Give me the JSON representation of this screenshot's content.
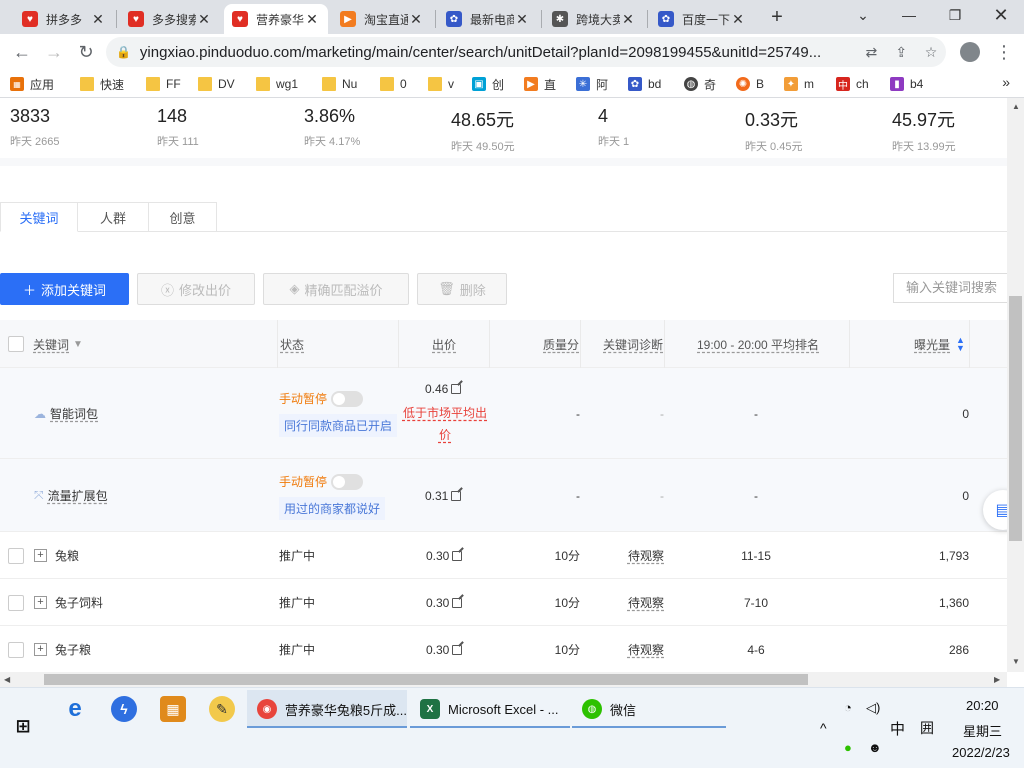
{
  "browser": {
    "tabs": [
      {
        "label": "拼多多",
        "fav_color": "#e02e24"
      },
      {
        "label": "多多搜索",
        "fav_color": "#e02e24"
      },
      {
        "label": "营养豪华",
        "fav_color": "#e02e24",
        "active": true
      },
      {
        "label": "淘宝直通",
        "fav_color": "#f27c20"
      },
      {
        "label": "最新电商",
        "fav_color": "#3659c8"
      },
      {
        "label": "跨境大卖",
        "fav_color": "#555555"
      },
      {
        "label": "百度一下",
        "fav_color": "#3659c8"
      }
    ],
    "url": "yingxiao.pinduoduo.com/marketing/main/center/search/unitDetail?planId=2098199455&unitId=25749...",
    "bookmarks": [
      {
        "label": "应用"
      },
      {
        "label": "快速"
      },
      {
        "label": "FF"
      },
      {
        "label": "DV"
      },
      {
        "label": "wg1"
      },
      {
        "label": "Nu"
      },
      {
        "label": "0"
      },
      {
        "label": "v"
      },
      {
        "label": "创"
      },
      {
        "label": "直"
      },
      {
        "label": "阿"
      },
      {
        "label": "bd"
      },
      {
        "label": "奇"
      },
      {
        "label": "B"
      },
      {
        "label": "m"
      },
      {
        "label": "ch"
      },
      {
        "label": "b4"
      }
    ]
  },
  "stats": [
    {
      "value": "3833",
      "yesterday": "昨天 2665"
    },
    {
      "value": "148",
      "yesterday": "昨天 111"
    },
    {
      "value": "3.86%",
      "yesterday": "昨天 4.17%"
    },
    {
      "value": "48.65元",
      "yesterday": "昨天 49.50元"
    },
    {
      "value": "4",
      "yesterday": "昨天 1"
    },
    {
      "value": "0.33元",
      "yesterday": "昨天 0.45元"
    },
    {
      "value": "45.97元",
      "yesterday": "昨天 13.99元"
    }
  ],
  "page_tabs": [
    "关键词",
    "人群",
    "创意"
  ],
  "actions": {
    "add": "添加关键词",
    "modify": "修改出价",
    "precise": "精确匹配溢价",
    "delete": "删除",
    "search_placeholder": "输入关键词搜索"
  },
  "table": {
    "headers": {
      "keyword": "关键词",
      "status": "状态",
      "bid": "出价",
      "quality": "质量分",
      "diagnosis": "关键词诊断",
      "rank": "19:00 - 20:00 平均排名",
      "exposure": "曝光量"
    },
    "special_rows": [
      {
        "name": "智能词包",
        "status": "手动暂停",
        "note": "同行同款商品已开启",
        "bid": "0.46",
        "bid_warn": "低于市场平均出价",
        "quality": "-",
        "diagnosis": "-",
        "rank": "-",
        "exposure": "0"
      },
      {
        "name": "流量扩展包",
        "status": "手动暂停",
        "note": "用过的商家都说好",
        "bid": "0.31",
        "quality": "-",
        "diagnosis": "-",
        "rank": "-",
        "exposure": "0"
      }
    ],
    "rows": [
      {
        "keyword": "兔粮",
        "status": "推广中",
        "bid": "0.30",
        "quality": "10分",
        "diagnosis": "待观察",
        "rank": "11-15",
        "exposure": "1,793"
      },
      {
        "keyword": "兔子饲料",
        "status": "推广中",
        "bid": "0.30",
        "quality": "10分",
        "diagnosis": "待观察",
        "rank": "7-10",
        "exposure": "1,360"
      },
      {
        "keyword": "兔子粮",
        "status": "推广中",
        "bid": "0.30",
        "quality": "10分",
        "diagnosis": "待观察",
        "rank": "4-6",
        "exposure": "286"
      }
    ]
  },
  "taskbar": {
    "chrome_app": "营养豪华兔粮5斤成...",
    "excel_app": "Microsoft Excel - ...",
    "wechat_app": "微信",
    "ime": "中",
    "time": "20:20",
    "weekday": "星期三",
    "date": "2022/2/23"
  }
}
